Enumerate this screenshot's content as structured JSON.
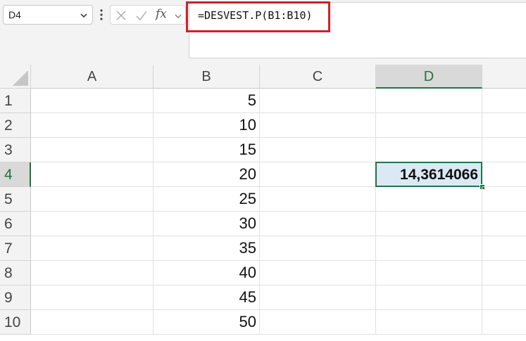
{
  "name_box": {
    "value": "D4",
    "icon": "chevron-down-icon"
  },
  "formula_bar": {
    "cancel_icon": "close-icon",
    "enter_icon": "checkmark-icon",
    "fx_label": "fx",
    "formula": "=DESVEST.P(B1:B10)",
    "highlight_color": "#d0202b"
  },
  "columns": [
    "A",
    "B",
    "C",
    "D"
  ],
  "rows": [
    "1",
    "2",
    "3",
    "4",
    "5",
    "6",
    "7",
    "8",
    "9",
    "10"
  ],
  "cells": {
    "B": [
      "5",
      "10",
      "15",
      "20",
      "25",
      "30",
      "35",
      "40",
      "45",
      "50"
    ],
    "D4": "14,3614066"
  },
  "selection": {
    "column": "D",
    "row": "4",
    "accent": "#217346"
  }
}
